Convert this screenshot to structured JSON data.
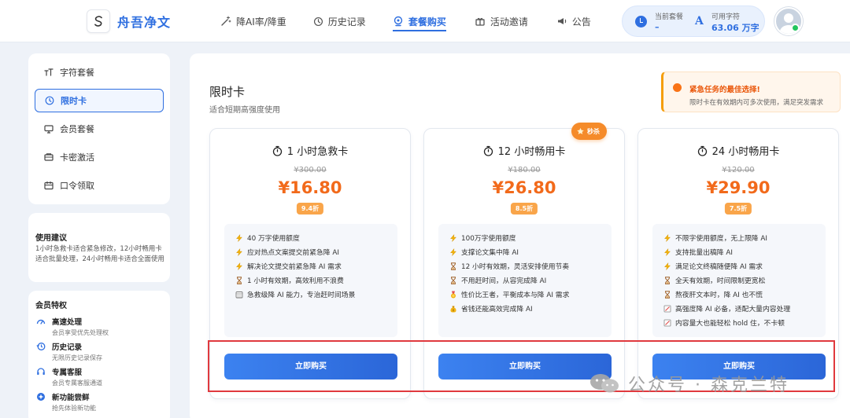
{
  "app": {
    "name": "舟吾净文"
  },
  "nav": [
    {
      "label": "降AI率/降重",
      "icon": "magic-wand-icon"
    },
    {
      "label": "历史记录",
      "icon": "history-icon"
    },
    {
      "label": "套餐购买",
      "icon": "package-icon",
      "active": true
    },
    {
      "label": "活动邀请",
      "icon": "gift-icon"
    },
    {
      "label": "公告",
      "icon": "megaphone-icon"
    }
  ],
  "status": {
    "plan_label": "当前套餐",
    "plan_value": "–",
    "chars_label": "可用字符",
    "chars_value": "63.06 万字"
  },
  "sidebar": {
    "menu": [
      {
        "label": "字符套餐",
        "icon": "text-size-icon"
      },
      {
        "label": "限时卡",
        "icon": "clock-icon",
        "active": true
      },
      {
        "label": "会员套餐",
        "icon": "monitor-icon"
      },
      {
        "label": "卡密激活",
        "icon": "card-icon"
      },
      {
        "label": "口令领取",
        "icon": "ticket-icon"
      }
    ],
    "tips": {
      "title": "使用建议",
      "body": "1小时急救卡适合紧急修改，12小时畅用卡适合批量处理，24小时畅用卡适合全面使用"
    },
    "features": {
      "title": "会员特权",
      "items": [
        {
          "name": "高速处理",
          "desc": "会员享受优先处理权",
          "icon": "speedometer-icon"
        },
        {
          "name": "历史记录",
          "desc": "无限历史记录保存",
          "icon": "history-icon"
        },
        {
          "name": "专属客服",
          "desc": "会员专属客服通道",
          "icon": "headset-icon"
        },
        {
          "name": "新功能尝鲜",
          "desc": "抢先体验新功能",
          "icon": "sparkle-icon"
        }
      ]
    }
  },
  "main": {
    "title": "限时卡",
    "subtitle": "适合短期高强度使用",
    "urgent": {
      "title": "紧急任务的最佳选择!",
      "subtitle": "限时卡在有效期内可多次使用，满足突发需求"
    },
    "cards": [
      {
        "title": "1 小时急救卡",
        "original_price": "¥300.00",
        "price": "¥16.80",
        "discount": "9.4折",
        "badge": "",
        "features": [
          {
            "icon": "lightning-icon",
            "text": "40 万字使用额度"
          },
          {
            "icon": "lightning-icon",
            "text": "应对热点文案提交前紧急降 AI"
          },
          {
            "icon": "lightning-icon",
            "text": "解决论文提交前紧急降 AI 需求"
          },
          {
            "icon": "hourglass-icon",
            "text": "1 小时有效期，高效利用不浪费"
          },
          {
            "icon": "calendar-icon",
            "text": "急救级降 AI 能力，专治赶时间场景"
          }
        ],
        "button": "立即购买"
      },
      {
        "title": "12 小时畅用卡",
        "original_price": "¥180.00",
        "price": "¥26.80",
        "discount": "8.5折",
        "badge": "秒杀",
        "features": [
          {
            "icon": "lightning-icon",
            "text": "100万字使用额度"
          },
          {
            "icon": "lightning-icon",
            "text": "支撑论文集中降 AI"
          },
          {
            "icon": "hourglass-icon",
            "text": "12 小时有效期，灵活安排使用节奏"
          },
          {
            "icon": "hourglass-icon",
            "text": "不用赶时间，从容完成降 AI"
          },
          {
            "icon": "medal-icon",
            "text": "性价比王者，平衡成本与降 AI 需求"
          },
          {
            "icon": "coin-icon",
            "text": "省钱还能高效完成降 AI"
          }
        ],
        "button": "立即购买"
      },
      {
        "title": "24 小时畅用卡",
        "original_price": "¥120.00",
        "price": "¥29.90",
        "discount": "7.5折",
        "badge": "",
        "features": [
          {
            "icon": "lightning-icon",
            "text": "不限字使用额度，无上限降 AI"
          },
          {
            "icon": "lightning-icon",
            "text": "支持批量出稿降 AI"
          },
          {
            "icon": "lightning-icon",
            "text": "满足论文终稿随便降 AI 需求"
          },
          {
            "icon": "hourglass-icon",
            "text": "全天有效期，时间限制更宽松"
          },
          {
            "icon": "hourglass-icon",
            "text": "熬夜肝文本时，降 AI 也不慌"
          },
          {
            "icon": "memo-icon",
            "text": "高强度降 AI 必备，适配大量内容处理"
          },
          {
            "icon": "memo-icon",
            "text": "内容量大也能轻松 hold 住，不卡顿"
          }
        ],
        "button": "立即购买"
      }
    ]
  },
  "watermark": {
    "text": "公众号 · 森克兰特"
  },
  "colors": {
    "accent": "#2f6fe0",
    "price": "#f26a1b",
    "discount": "#f9a54a",
    "highlight_border": "#e0393e"
  }
}
